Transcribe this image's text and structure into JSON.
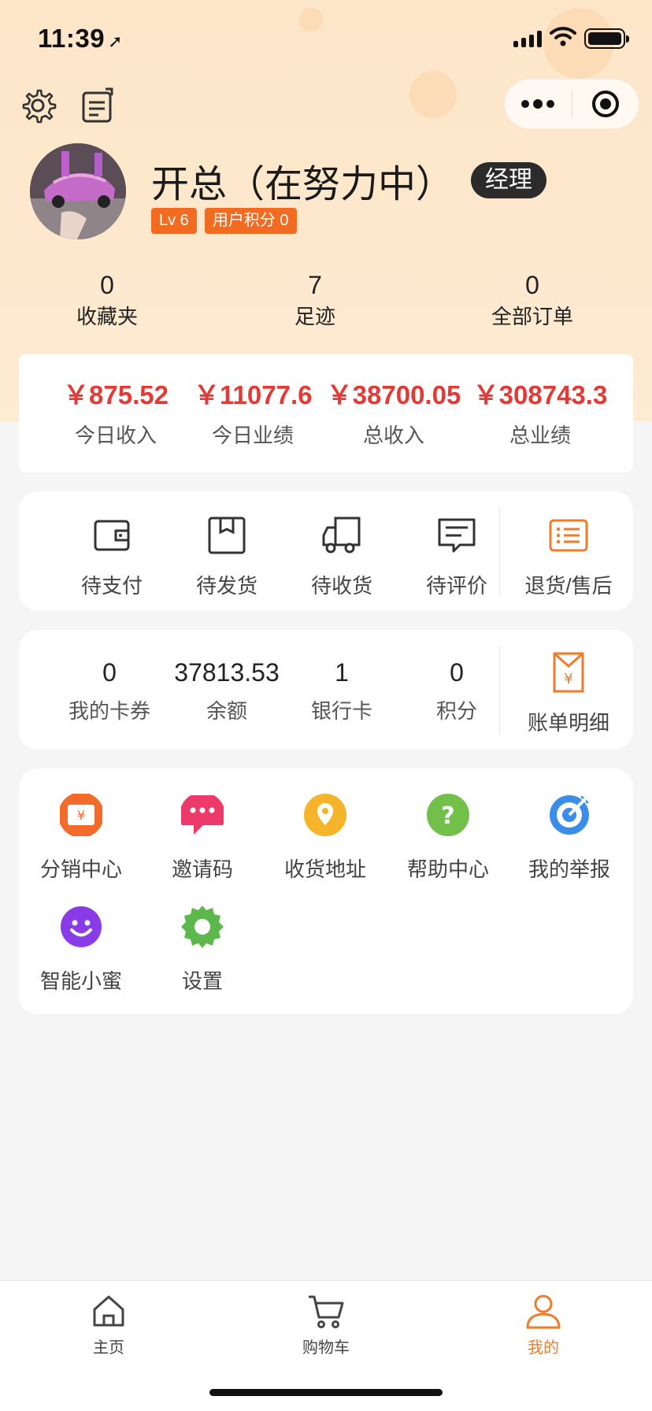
{
  "status_bar": {
    "time": "11:39"
  },
  "profile": {
    "name": "开总（在努力中）",
    "role": "经理",
    "tags": [
      "Lv 6",
      "用户积分 0"
    ]
  },
  "stats": [
    {
      "value": "0",
      "label": "收藏夹"
    },
    {
      "value": "7",
      "label": "足迹"
    },
    {
      "value": "0",
      "label": "全部订单"
    }
  ],
  "income": [
    {
      "value": "￥875.52",
      "label": "今日收入"
    },
    {
      "value": "￥11077.6",
      "label": "今日业绩"
    },
    {
      "value": "￥38700.05",
      "label": "总收入"
    },
    {
      "value": "￥308743.3",
      "label": "总业绩"
    }
  ],
  "orders": [
    {
      "label": "待支付",
      "icon": "wallet-icon"
    },
    {
      "label": "待发货",
      "icon": "box-icon"
    },
    {
      "label": "待收货",
      "icon": "truck-icon"
    },
    {
      "label": "待评价",
      "icon": "comment-icon"
    },
    {
      "label": "退货/售后",
      "icon": "list-icon"
    }
  ],
  "wallet": [
    {
      "value": "0",
      "label": "我的卡券"
    },
    {
      "value": "37813.53",
      "label": "余额"
    },
    {
      "value": "1",
      "label": "银行卡"
    },
    {
      "value": "0",
      "label": "积分"
    }
  ],
  "bill": {
    "label": "账单明细",
    "icon": "bill-icon"
  },
  "services": [
    {
      "label": "分销中心",
      "icon": "distribution-icon",
      "color": "#f26b2a"
    },
    {
      "label": "邀请码",
      "icon": "chat-icon",
      "color": "#ec3b6b"
    },
    {
      "label": "收货地址",
      "icon": "location-icon",
      "color": "#f5b42a"
    },
    {
      "label": "帮助中心",
      "icon": "help-icon",
      "color": "#72c04a"
    },
    {
      "label": "我的举报",
      "icon": "target-icon",
      "color": "#3a8de8"
    },
    {
      "label": "智能小蜜",
      "icon": "assistant-icon",
      "color": "#8a3be8"
    },
    {
      "label": "设置",
      "icon": "settings-icon",
      "color": "#5cb84a"
    }
  ],
  "tabbar": [
    {
      "label": "主页",
      "icon": "home-icon"
    },
    {
      "label": "购物车",
      "icon": "cart-icon"
    },
    {
      "label": "我的",
      "icon": "user-icon",
      "active": true
    }
  ],
  "colors": {
    "accent": "#f07b2a",
    "money": "#e53935",
    "tag": "#f36b21"
  }
}
